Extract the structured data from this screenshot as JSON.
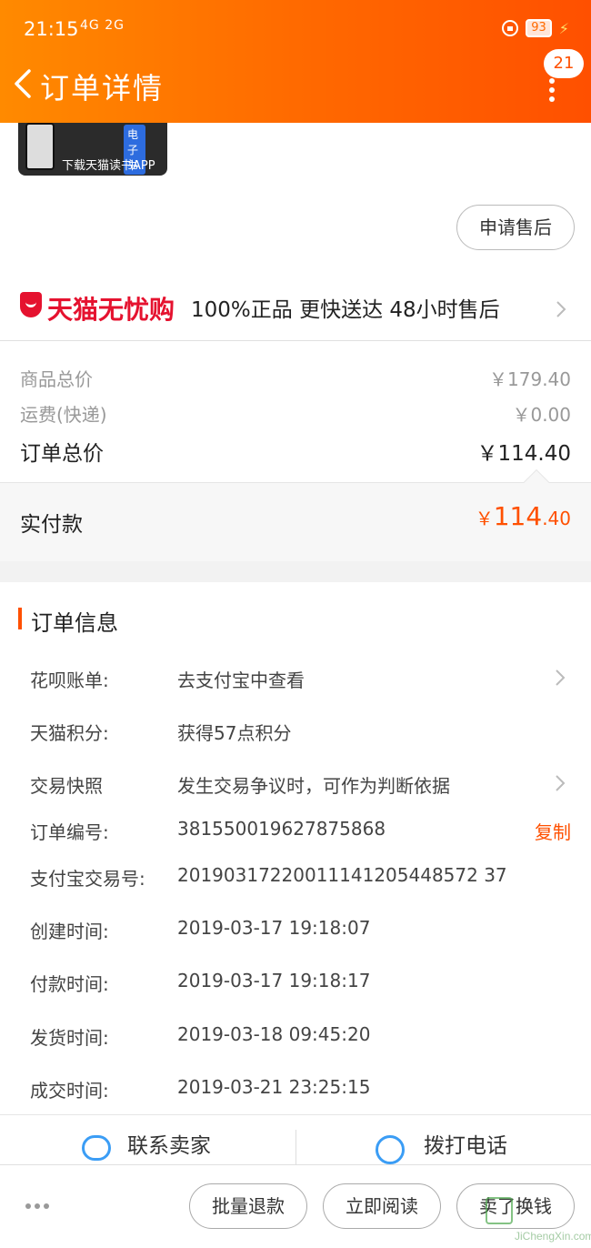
{
  "status_bar": {
    "time": "21:15",
    "signal": "4G 2G",
    "battery": "93"
  },
  "header": {
    "title": "订单详情",
    "badge_count": "21"
  },
  "ad": {
    "tag": "电子书",
    "text": "下载天猫读书APP"
  },
  "after_sale_button": "申请售后",
  "tmall_guarantee": {
    "brand": "天猫无忧购",
    "features": "100%正品  更快送达  48小时售后"
  },
  "price": {
    "goods_total_label": "商品总价",
    "goods_total_value": "￥179.40",
    "shipping_label": "运费(快递)",
    "shipping_value": "￥0.00",
    "order_total_label": "订单总价",
    "order_total_value": "￥114.40",
    "paid_label": "实付款",
    "paid_currency": "￥",
    "paid_int": "114",
    "paid_dec": ".40"
  },
  "order_info": {
    "title": "订单信息",
    "rows": [
      {
        "label": "花呗账单:",
        "value": "去支付宝中查看"
      },
      {
        "label": "天猫积分:",
        "value": "获得57点积分"
      },
      {
        "label": "交易快照",
        "value": "发生交易争议时，可作为判断依据"
      },
      {
        "label": "订单编号:",
        "value": "381550019627875868"
      },
      {
        "label": "支付宝交易号:",
        "value": "20190317220011141205448572 37"
      },
      {
        "label": "创建时间:",
        "value": "2019-03-17 19:18:07"
      },
      {
        "label": "付款时间:",
        "value": "2019-03-17 19:18:17"
      },
      {
        "label": "发货时间:",
        "value": "2019-03-18 09:45:20"
      },
      {
        "label": "成交时间:",
        "value": "2019-03-21 23:25:15"
      }
    ],
    "copy_label": "复制"
  },
  "contact": {
    "seller": "联系卖家",
    "phone": "拨打电话"
  },
  "actions": {
    "batch_refund": "批量退款",
    "read_now": "立即阅读",
    "sell_for_cash": "卖了换钱"
  },
  "watermark": {
    "text": "JiChengXin.com"
  },
  "colors": {
    "accent": "#ff5000",
    "tmall_red": "#e5122f"
  }
}
